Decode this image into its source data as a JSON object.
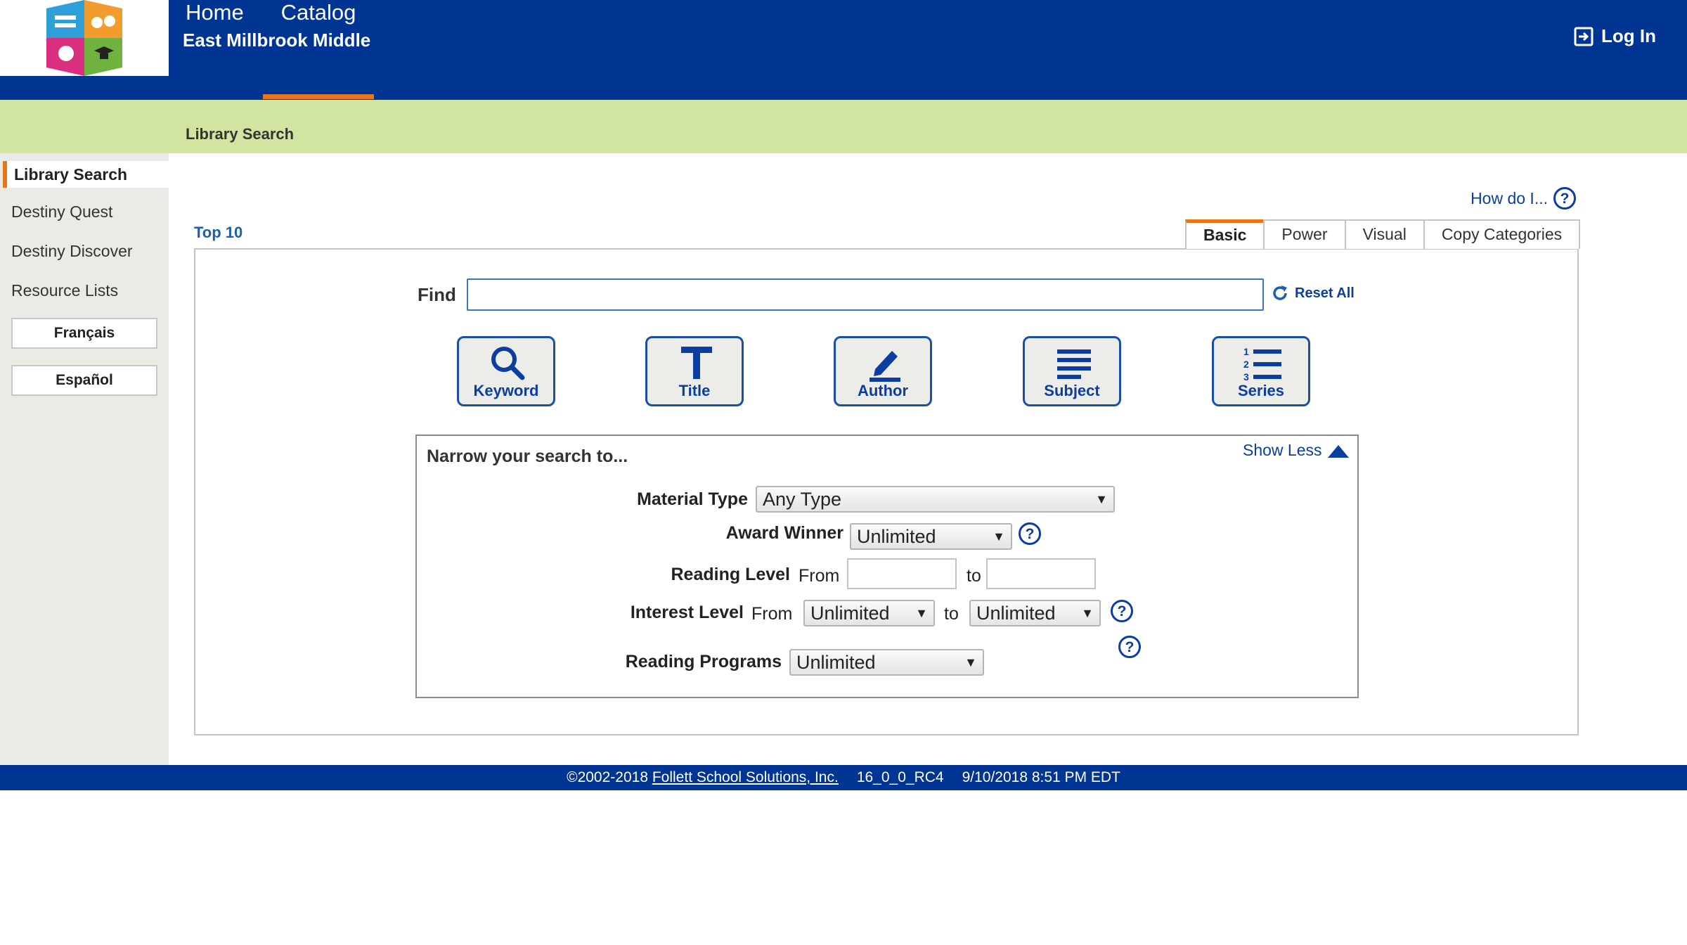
{
  "header": {
    "school_name": "East Millbrook Middle",
    "login_label": "Log In",
    "nav": {
      "home": "Home",
      "catalog": "Catalog"
    }
  },
  "subheader": {
    "title": "Library Search"
  },
  "sidebar": {
    "active": "Library Search",
    "links": [
      "Destiny Quest",
      "Destiny Discover",
      "Resource Lists"
    ],
    "languages": [
      "Français",
      "Español"
    ]
  },
  "main": {
    "how_do_i": "How do I...",
    "top10": "Top 10",
    "tabs": [
      "Basic",
      "Power",
      "Visual",
      "Copy Categories"
    ],
    "active_tab": "Basic",
    "find_label": "Find",
    "find_value": "",
    "reset_all": "Reset All",
    "search_buttons": [
      "Keyword",
      "Title",
      "Author",
      "Subject",
      "Series"
    ]
  },
  "narrow": {
    "title": "Narrow your search to...",
    "show_less": "Show Less",
    "material_type": {
      "label": "Material Type",
      "value": "Any Type"
    },
    "award_winner": {
      "label": "Award Winner",
      "value": "Unlimited"
    },
    "reading_level": {
      "label": "Reading Level",
      "from": "From",
      "to": "to"
    },
    "interest_level": {
      "label": "Interest Level",
      "from": "From",
      "to": "to",
      "from_value": "Unlimited",
      "to_value": "Unlimited"
    },
    "reading_programs": {
      "label": "Reading Programs",
      "value": "Unlimited"
    }
  },
  "footer": {
    "copyright": "©2002-2018",
    "company": "Follett School Solutions, Inc.",
    "version": "16_0_0_RC4",
    "timestamp": "9/10/2018 8:51 PM EDT"
  },
  "colors": {
    "brand_blue": "#003594",
    "accent_orange": "#e8761a",
    "subbar_green": "#d1e5a1",
    "link_blue": "#0b3ea0"
  }
}
